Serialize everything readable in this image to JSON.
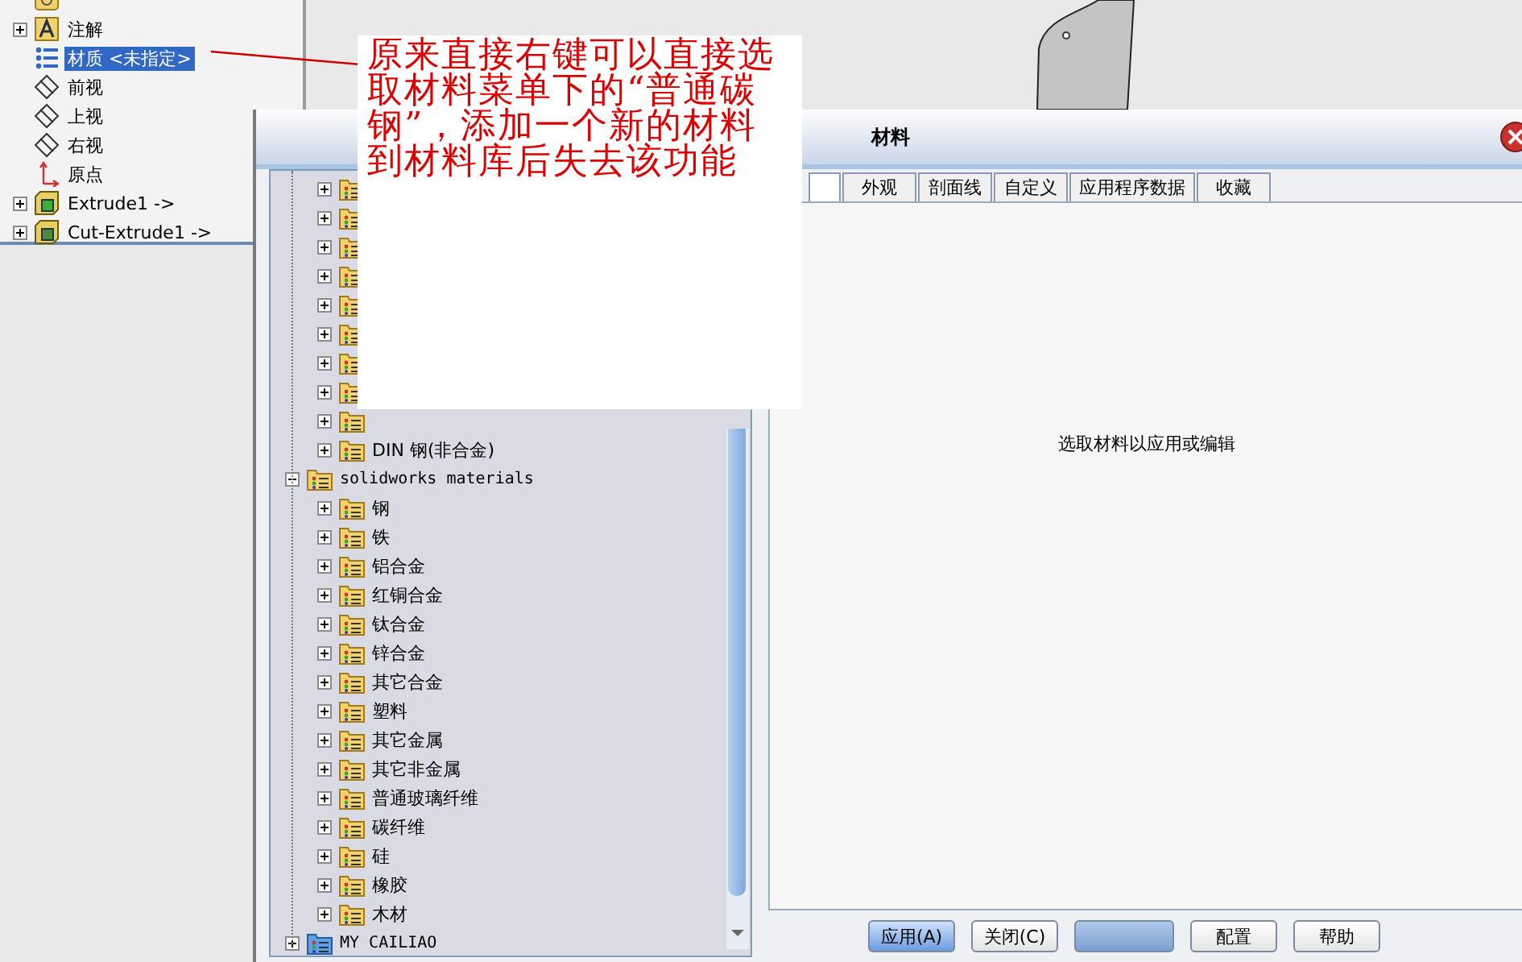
{
  "feature_tree": {
    "items": [
      {
        "kind": "sensor"
      },
      {
        "label": "注解",
        "kind": "annotation",
        "expandable": true,
        "selected": false
      },
      {
        "label": "材质 <未指定>",
        "kind": "material",
        "expandable": false,
        "selected": true
      },
      {
        "label": "前视",
        "kind": "plane",
        "expandable": false,
        "selected": false
      },
      {
        "label": "上视",
        "kind": "plane",
        "expandable": false,
        "selected": false
      },
      {
        "label": "右视",
        "kind": "plane",
        "expandable": false,
        "selected": false
      },
      {
        "label": "原点",
        "kind": "origin",
        "expandable": false,
        "selected": false
      },
      {
        "label": "Extrude1 ->",
        "kind": "extrude",
        "expandable": true,
        "selected": false
      },
      {
        "label": "Cut-Extrude1 ->",
        "kind": "cut",
        "expandable": true,
        "selected": false
      }
    ]
  },
  "annotation": {
    "text": "原来直接右键可以直接选取材料菜单下的“普通碳钢”，添加一个新的材料到材料库后失去该功能"
  },
  "dialog": {
    "title": "材料",
    "library_tree": {
      "upper_items": [
        {
          "expanded": false
        },
        {
          "expanded": false
        },
        {
          "expanded": false
        },
        {
          "expanded": false
        },
        {
          "expanded": false
        },
        {
          "expanded": false
        },
        {
          "expanded": false
        },
        {
          "expanded": false
        },
        {
          "expanded": false
        },
        {
          "label": "DIN 钢(非合金)",
          "expanded": false
        }
      ],
      "roots": [
        {
          "label": "solidworks materials",
          "kind": "library",
          "expanded": true,
          "children": [
            {
              "label": "钢",
              "expanded": false
            },
            {
              "label": "铁",
              "expanded": false
            },
            {
              "label": "铝合金",
              "expanded": false
            },
            {
              "label": "红铜合金",
              "expanded": false
            },
            {
              "label": "钛合金",
              "expanded": false
            },
            {
              "label": "锌合金",
              "expanded": false
            },
            {
              "label": "其它合金",
              "expanded": false
            },
            {
              "label": "塑料",
              "expanded": false
            },
            {
              "label": "其它金属",
              "expanded": false
            },
            {
              "label": "其它非金属",
              "expanded": false
            },
            {
              "label": "普通玻璃纤维",
              "expanded": false
            },
            {
              "label": "碳纤维",
              "expanded": false
            },
            {
              "label": "硅",
              "expanded": false
            },
            {
              "label": "橡胶",
              "expanded": false
            },
            {
              "label": "木材",
              "expanded": false
            }
          ]
        },
        {
          "label": "MY CAILIAO",
          "kind": "custom",
          "expanded": false
        }
      ]
    },
    "tabs": [
      {
        "selected": true
      },
      {
        "label": "外观",
        "selected": false
      },
      {
        "label": "剖面线",
        "selected": false
      },
      {
        "label": "自定义",
        "selected": false
      },
      {
        "label": "应用程序数据",
        "selected": false
      },
      {
        "label": "收藏",
        "selected": false
      }
    ],
    "message": "选取材料以应用或编辑",
    "buttons": [
      {
        "label": "应用(A)",
        "kind": "default"
      },
      {
        "label": "关闭(C)",
        "kind": "normal"
      },
      {
        "kind": "disabled"
      },
      {
        "label": "配置",
        "kind": "normal"
      },
      {
        "label": "帮助",
        "kind": "normal"
      }
    ]
  }
}
